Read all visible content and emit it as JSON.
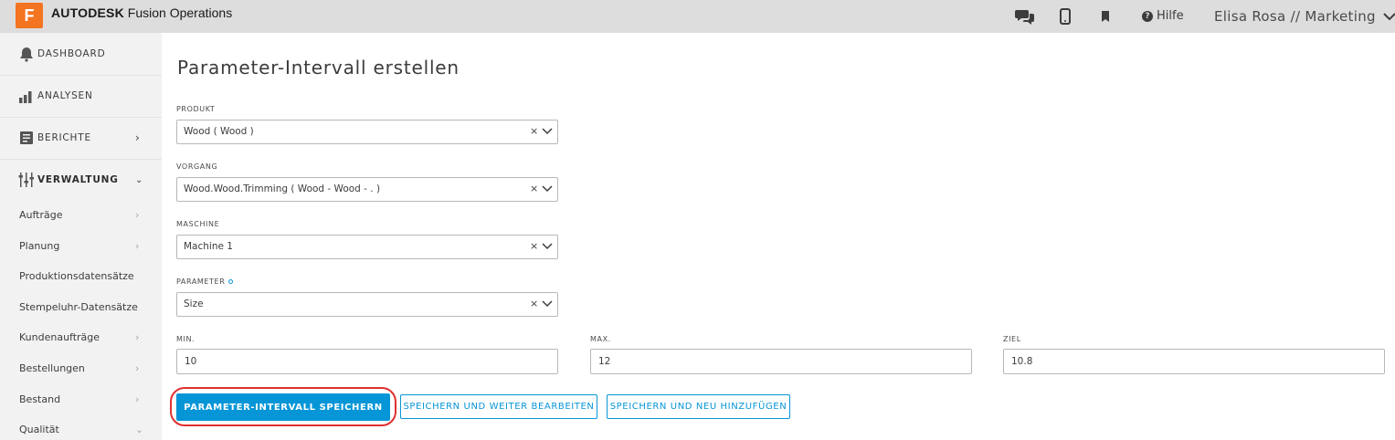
{
  "app": {
    "logo_letter": "F",
    "brand_bold": "AUTODESK",
    "brand_rest": " Fusion Operations",
    "help_label": "Hilfe",
    "user_label": "Elisa Rosa // Marketing",
    "accent_color": "#0696d7",
    "logo_color": "#f37421"
  },
  "sidebar": {
    "main": [
      {
        "label": "DASHBOARD",
        "icon": "bell-icon"
      },
      {
        "label": "ANALYSEN",
        "icon": "bar-chart-icon"
      },
      {
        "label": "BERICHTE",
        "icon": "document-icon"
      },
      {
        "label": "VERWALTUNG",
        "icon": "sliders-icon"
      }
    ],
    "sub": [
      {
        "label": "Aufträge"
      },
      {
        "label": "Planung"
      },
      {
        "label": "Produktionsdatensätze"
      },
      {
        "label": "Stempeluhr-Datensätze"
      },
      {
        "label": "Kundenaufträge"
      },
      {
        "label": "Bestellungen"
      },
      {
        "label": "Bestand"
      },
      {
        "label": "Qualität"
      }
    ]
  },
  "form": {
    "title": "Parameter-Intervall erstellen",
    "produkt": {
      "label": "PRODUKT",
      "value": "Wood ( Wood )"
    },
    "vorgang": {
      "label": "VORGANG",
      "value": "Wood.Wood.Trimming ( Wood - Wood - . )"
    },
    "maschine": {
      "label": "MASCHINE",
      "value": "Machine 1"
    },
    "parameter": {
      "label": "PARAMETER",
      "value": "Size"
    },
    "min": {
      "label": "MIN.",
      "value": "10"
    },
    "max": {
      "label": "MAX.",
      "value": "12"
    },
    "ziel": {
      "label": "ZIEL",
      "value": "10.8"
    },
    "clear_glyph": "×",
    "buttons": {
      "save": "PARAMETER-INTERVALL SPEICHERN",
      "save_continue": "SPEICHERN UND WEITER BEARBEITEN",
      "save_add": "SPEICHERN UND NEU HINZUFÜGEN"
    }
  }
}
